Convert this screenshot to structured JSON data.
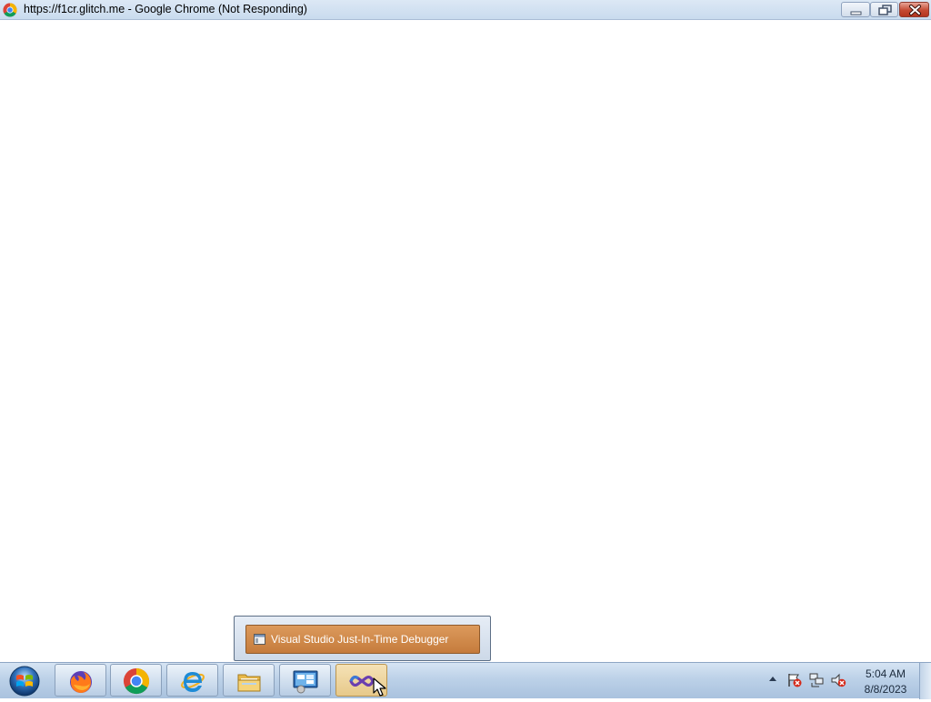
{
  "window": {
    "title": "https://f1cr.glitch.me - Google Chrome (Not Responding)",
    "icon": "chrome-icon"
  },
  "taskbar": {
    "start_icon": "windows-start-orb-icon",
    "pinned": [
      {
        "name": "firefox",
        "icon": "firefox-icon"
      },
      {
        "name": "chrome",
        "icon": "chrome-icon"
      },
      {
        "name": "internet-explorer",
        "icon": "internet-explorer-icon"
      },
      {
        "name": "file-explorer",
        "icon": "folder-icon"
      },
      {
        "name": "remote-desktop",
        "icon": "control-panel-icon"
      },
      {
        "name": "visual-studio-debugger",
        "icon": "visual-studio-icon",
        "active": true
      }
    ],
    "popup": {
      "item_label": "Visual Studio Just-In-Time Debugger",
      "item_icon": "window-icon"
    },
    "clock": {
      "time": "5:04 AM",
      "date": "8/8/2023"
    },
    "tray_icons": [
      "show-hidden-icons-arrow",
      "action-center-flag-icon",
      "network-icon",
      "speaker-muted-icon"
    ]
  },
  "colors": {
    "popup_item": "#c98040",
    "close_button": "#c44a33"
  }
}
